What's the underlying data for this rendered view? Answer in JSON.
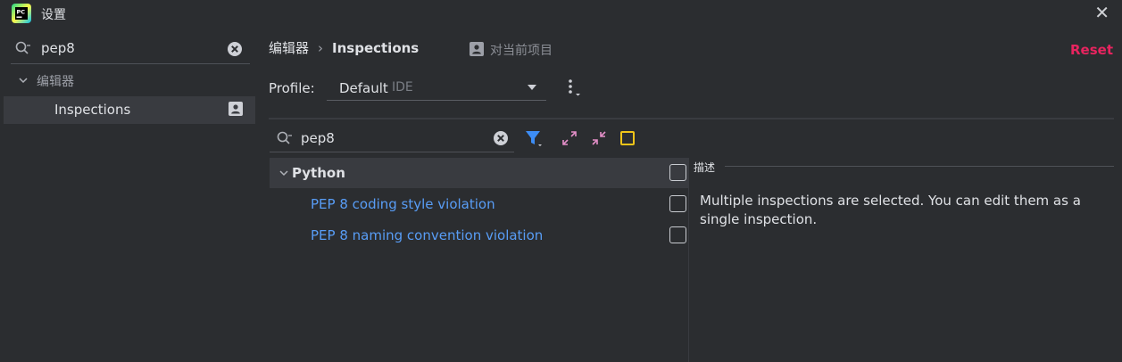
{
  "window": {
    "title": "设置",
    "close_icon": "close-icon"
  },
  "sidebar": {
    "search_value": "pep8",
    "group_label": "编辑器",
    "selected_item": "Inspections"
  },
  "header": {
    "breadcrumb_parent": "编辑器",
    "breadcrumb_separator": "›",
    "breadcrumb_current": "Inspections",
    "scope_label": "对当前项目",
    "reset_label": "Reset"
  },
  "profile": {
    "label": "Profile:",
    "value": "Default",
    "scope": "IDE"
  },
  "inspections": {
    "filter_value": "pep8",
    "group": {
      "label": "Python"
    },
    "items": [
      {
        "label": "PEP 8 coding style violation"
      },
      {
        "label": "PEP 8 naming convention violation"
      }
    ]
  },
  "description": {
    "title": "描述",
    "text": "Multiple inspections are selected. You can edit them as a single inspection."
  },
  "colors": {
    "accent_reset": "#e8245f",
    "link": "#589df6",
    "filter_icon": "#3d8df5",
    "highlight_box": "#f0c419"
  }
}
